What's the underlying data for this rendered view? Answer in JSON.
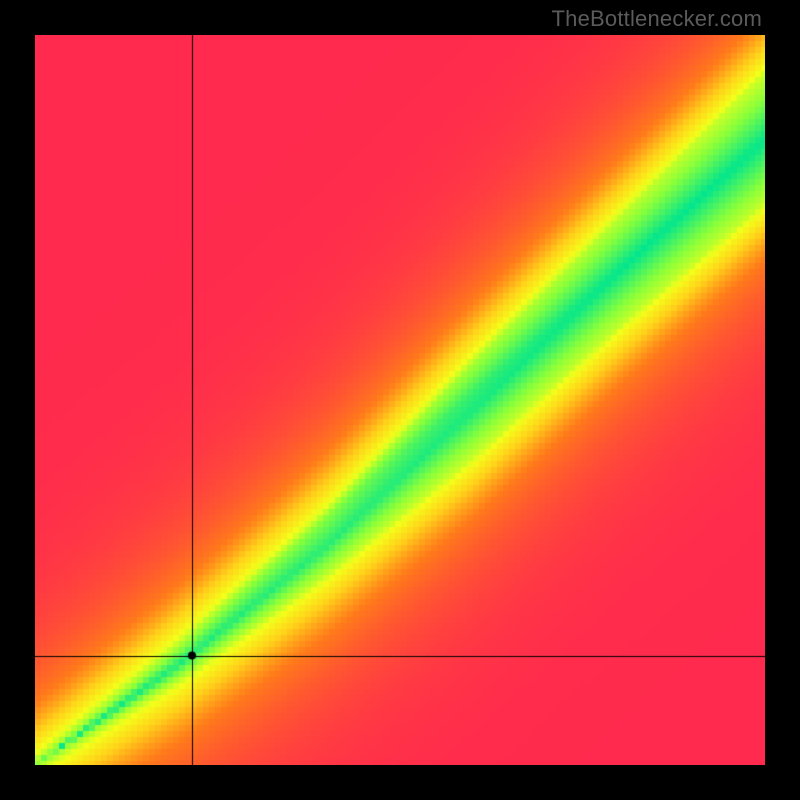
{
  "watermark": "TheBottlenecker.com",
  "chart_data": {
    "type": "heatmap",
    "title": "",
    "xlabel": "",
    "ylabel": "",
    "xlim": [
      0,
      100
    ],
    "ylim": [
      0,
      100
    ],
    "grid": false,
    "legend": false,
    "color_stops": [
      {
        "t": 0.0,
        "color": "#ff2a4d"
      },
      {
        "t": 0.35,
        "color": "#ff7a1a"
      },
      {
        "t": 0.55,
        "color": "#ffd21a"
      },
      {
        "t": 0.72,
        "color": "#f4ff1a"
      },
      {
        "t": 0.85,
        "color": "#8aff3a"
      },
      {
        "t": 1.0,
        "color": "#00e58f"
      }
    ],
    "diagonal": {
      "anchors": [
        {
          "x": 0,
          "yLow": 0,
          "yHigh": 0
        },
        {
          "x": 20,
          "yLow": 12,
          "yHigh": 16
        },
        {
          "x": 40,
          "yLow": 26,
          "yHigh": 34
        },
        {
          "x": 60,
          "yLow": 42,
          "yHigh": 55
        },
        {
          "x": 80,
          "yLow": 60,
          "yHigh": 75
        },
        {
          "x": 100,
          "yLow": 77,
          "yHigh": 95
        }
      ],
      "softness": 12
    },
    "crosshair": {
      "x": 21.5,
      "y": 15.0
    },
    "marker": {
      "x": 21.5,
      "y": 15.0,
      "radius": 4
    },
    "pixelation": 6
  }
}
